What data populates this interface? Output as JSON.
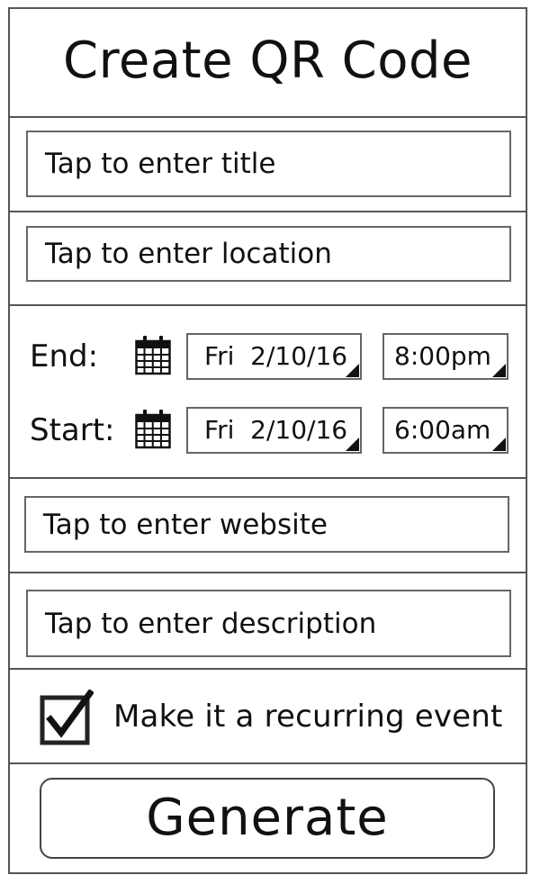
{
  "header": {
    "title": "Create QR Code"
  },
  "form": {
    "title_placeholder": "Tap to enter title",
    "location_placeholder": "Tap to enter location",
    "website_placeholder": "Tap to enter website",
    "description_placeholder": "Tap to enter description"
  },
  "schedule": {
    "end": {
      "label": "End:",
      "date": "Fri  2/10/16",
      "time": "8:00pm",
      "icon": "calendar-icon"
    },
    "start": {
      "label": "Start:",
      "date": "Fri  2/10/16",
      "time": "6:00am",
      "icon": "calendar-icon"
    }
  },
  "recurring": {
    "label": "Make it a recurring event",
    "checked": true,
    "icon": "checkbox-checked-icon"
  },
  "actions": {
    "generate_label": "Generate"
  }
}
